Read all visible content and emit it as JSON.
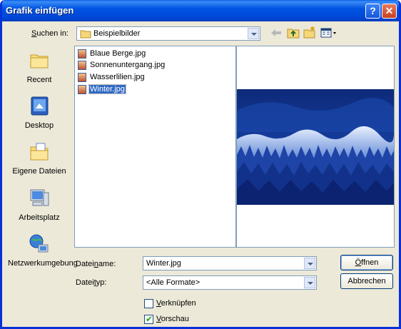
{
  "window": {
    "title": "Grafik einfügen"
  },
  "titlebar": {
    "help": "?",
    "close": "✕"
  },
  "lookin": {
    "label": "Suchen in:",
    "value": "Beispielbilder"
  },
  "places": [
    {
      "label": "Recent",
      "icon": "recent-folder-icon"
    },
    {
      "label": "Desktop",
      "icon": "desktop-icon"
    },
    {
      "label": "Eigene Dateien",
      "icon": "my-documents-icon"
    },
    {
      "label": "Arbeitsplatz",
      "icon": "my-computer-icon"
    },
    {
      "label": "Netzwerkumgebung",
      "icon": "network-places-icon"
    }
  ],
  "files": [
    {
      "name": "Blaue Berge.jpg"
    },
    {
      "name": "Sonnenuntergang.jpg"
    },
    {
      "name": "Wasserlilien.jpg"
    },
    {
      "name": "Winter.jpg",
      "selected": true
    }
  ],
  "filename": {
    "label": "Dateiname:",
    "value": "Winter.jpg"
  },
  "filetype": {
    "label": "Dateityp:",
    "value": "<Alle Formate>"
  },
  "buttons": {
    "open": "Öffnen",
    "cancel": "Abbrechen"
  },
  "options": {
    "link": "Verknüpfen",
    "link_checked": false,
    "preview": "Vorschau",
    "preview_checked": true
  },
  "colors": {
    "titlebar": "#0054e3",
    "selection": "#316ac5",
    "face": "#ece9d8"
  }
}
